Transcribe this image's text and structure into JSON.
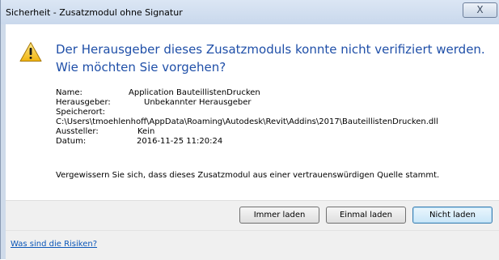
{
  "window": {
    "title": "Sicherheit - Zusatzmodul ohne Signatur",
    "close_glyph": "X"
  },
  "content": {
    "icon": "warning-icon",
    "headline": "Der Herausgeber dieses Zusatzmoduls konnte nicht verifiziert werden. Wie möchten Sie vorgehen?",
    "info": {
      "name_label": "Name:",
      "name_value": "Application BauteillistenDrucken",
      "publisher_label": "Herausgeber:",
      "publisher_value": "Unbekannter Herausgeber",
      "location_label": "Speicherort:",
      "location_value": "C:\\Users\\tmoehlenhoff\\AppData\\Roaming\\Autodesk\\Revit\\Addins\\2017\\BauteillistenDrucken.dll",
      "issuer_label": "Aussteller:",
      "issuer_value": "Kein",
      "date_label": "Datum:",
      "date_value": "2016-11-25 11:20:24"
    },
    "notice": "Vergewissern Sie sich, dass dieses Zusatzmodul aus einer vertrauenswürdigen Quelle stammt."
  },
  "buttons": {
    "always_load": "Immer laden",
    "load_once": "Einmal laden",
    "do_not_load": "Nicht laden"
  },
  "footer": {
    "risk_link": "Was sind die Risiken?"
  },
  "colors": {
    "headline": "#1f4fa8",
    "link": "#0b56b8",
    "warning_fill": "#f7c22a"
  }
}
